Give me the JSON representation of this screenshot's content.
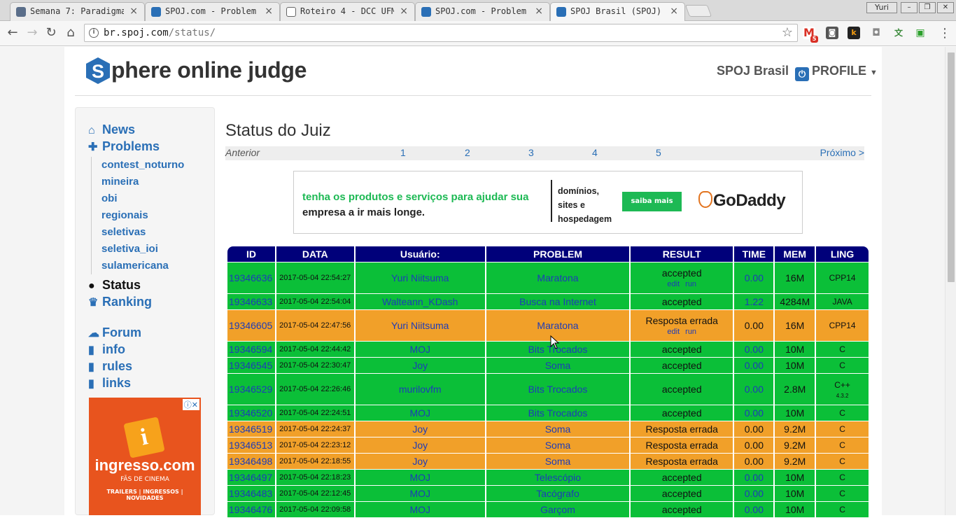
{
  "browser": {
    "tabs": [
      {
        "title": "Semana 7: Paradigma",
        "favicon_color": "#5a6e8a"
      },
      {
        "title": "SPOJ.com - Problem",
        "favicon_color": "#2a6fb6"
      },
      {
        "title": "Roteiro 4 - DCC UFM",
        "favicon_color": "#666666"
      },
      {
        "title": "SPOJ.com - Problem",
        "favicon_color": "#2a6fb6"
      },
      {
        "title": "SPOJ Brasil (SPOJ)",
        "favicon_color": "#2a6fb6"
      }
    ],
    "user": "Yuri",
    "url_host": "br.spoj.com",
    "url_path": "/status/",
    "extensions": [
      "gmail-icon",
      "keep-icon",
      "k-icon",
      "camera-icon",
      "translate-icon",
      "tv-icon"
    ],
    "gmail_badge": "5"
  },
  "header": {
    "logo_letter": "S",
    "logo_text": "phere online judge",
    "site_name": "SPOJ Brasil",
    "profile_label": "PROFILE"
  },
  "sidebar": {
    "news": "News",
    "problems": "Problems",
    "sub": [
      "contest_noturno",
      "mineira",
      "obi",
      "regionais",
      "seletivas",
      "seletiva_ioi",
      "sulamericana"
    ],
    "status": "Status",
    "ranking": "Ranking",
    "forum": "Forum",
    "info": "info",
    "rules": "rules",
    "links": "links"
  },
  "ad_left": {
    "brand": "ingresso.com",
    "tagline": "FÃS DE CINEMA",
    "footer": "TRAILERS | INGRESSOS | NOVIDADES"
  },
  "main": {
    "title": "Status do Juiz",
    "pager": {
      "prev": "Anterior",
      "pages": [
        "1",
        "2",
        "3",
        "4",
        "5"
      ],
      "next": "Próximo >"
    }
  },
  "banner": {
    "line1": "tenha os produtos e serviços para ajudar sua",
    "line2": "empresa a ir mais longe.",
    "side": "domínios, sites e hospedagem",
    "button": "saiba mais",
    "brand": "GoDaddy"
  },
  "table": {
    "headers": [
      "ID",
      "DATA",
      "Usuário:",
      "PROBLEM",
      "RESULT",
      "TIME",
      "MEM",
      "LING"
    ],
    "rows": [
      {
        "id": "19346636",
        "date": "2017-05-04 22:54:27",
        "user": "Yuri Niitsuma",
        "problem": "Maratona",
        "result": "accepted",
        "time": "0.00",
        "mem": "16M",
        "lang": "CPP14",
        "status": "ok",
        "links": true
      },
      {
        "id": "19346633",
        "date": "2017-05-04 22:54:04",
        "user": "Walteann_KDash",
        "problem": "Busca na Internet",
        "result": "accepted",
        "time": "1.22",
        "mem": "4284M",
        "lang": "JAVA",
        "status": "ok",
        "links": false
      },
      {
        "id": "19346605",
        "date": "2017-05-04 22:47:56",
        "user": "Yuri Niitsuma",
        "problem": "Maratona",
        "result": "Resposta errada",
        "time": "0.00",
        "mem": "16M",
        "lang": "CPP14",
        "status": "wa",
        "links": true
      },
      {
        "id": "19346594",
        "date": "2017-05-04 22:44:42",
        "user": "MOJ",
        "problem": "Bits Trocados",
        "result": "accepted",
        "time": "0.00",
        "mem": "10M",
        "lang": "C",
        "status": "ok",
        "links": false
      },
      {
        "id": "19346545",
        "date": "2017-05-04 22:30:47",
        "user": "Joy",
        "problem": "Soma",
        "result": "accepted",
        "time": "0.00",
        "mem": "10M",
        "lang": "C",
        "status": "ok",
        "links": false
      },
      {
        "id": "19346529",
        "date": "2017-05-04 22:26:46",
        "user": "murilovfm",
        "problem": "Bits Trocados",
        "result": "accepted",
        "time": "0.00",
        "mem": "2.8M",
        "lang": "C++",
        "lang_ver": "4.3.2",
        "status": "ok",
        "links": false
      },
      {
        "id": "19346520",
        "date": "2017-05-04 22:24:51",
        "user": "MOJ",
        "problem": "Bits Trocados",
        "result": "accepted",
        "time": "0.00",
        "mem": "10M",
        "lang": "C",
        "status": "ok",
        "links": false
      },
      {
        "id": "19346519",
        "date": "2017-05-04 22:24:37",
        "user": "Joy",
        "problem": "Soma",
        "result": "Resposta errada",
        "time": "0.00",
        "mem": "9.2M",
        "lang": "C",
        "status": "wa",
        "links": false
      },
      {
        "id": "19346513",
        "date": "2017-05-04 22:23:12",
        "user": "Joy",
        "problem": "Soma",
        "result": "Resposta errada",
        "time": "0.00",
        "mem": "9.2M",
        "lang": "C",
        "status": "wa",
        "links": false
      },
      {
        "id": "19346498",
        "date": "2017-05-04 22:18:55",
        "user": "Joy",
        "problem": "Soma",
        "result": "Resposta errada",
        "time": "0.00",
        "mem": "9.2M",
        "lang": "C",
        "status": "wa",
        "links": false
      },
      {
        "id": "19346497",
        "date": "2017-05-04 22:18:23",
        "user": "MOJ",
        "problem": "Telescópio",
        "result": "accepted",
        "time": "0.00",
        "mem": "10M",
        "lang": "C",
        "status": "ok",
        "links": false
      },
      {
        "id": "19346483",
        "date": "2017-05-04 22:12:45",
        "user": "MOJ",
        "problem": "Tacógrafo",
        "result": "accepted",
        "time": "0.00",
        "mem": "10M",
        "lang": "C",
        "status": "ok",
        "links": false
      },
      {
        "id": "19346476",
        "date": "2017-05-04 22:09:58",
        "user": "MOJ",
        "problem": "Garçom",
        "result": "accepted",
        "time": "0.00",
        "mem": "10M",
        "lang": "C",
        "status": "ok",
        "links": false
      }
    ],
    "edit_label": "edit",
    "run_label": "run"
  },
  "colors": {
    "accepted": "#0bbf38",
    "wrong": "#f1a029",
    "header": "#00007a",
    "link": "#2a6fb6"
  }
}
